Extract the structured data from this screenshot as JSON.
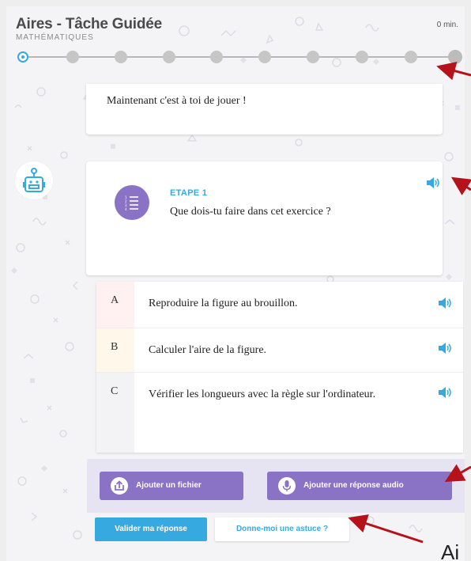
{
  "header": {
    "title": "Aires - Tâche Guidée",
    "subtitle": "MATHÉMATIQUES",
    "timer": "0 min."
  },
  "progress": {
    "current_step": 1,
    "total_steps": 10
  },
  "previous_card": {
    "text": "Maintenant c'est à toi de jouer !"
  },
  "step": {
    "label": "ETAPE 1",
    "question": "Que dois-tu faire dans cet exercice ?",
    "icon": "list-icon"
  },
  "answers": [
    {
      "letter": "A",
      "text": "Reproduire la figure au brouillon."
    },
    {
      "letter": "B",
      "text": "Calculer l'aire de la figure."
    },
    {
      "letter": "C",
      "text": "Vérifier les longueurs avec la règle sur l'ordinateur."
    }
  ],
  "actions": {
    "add_file": "Ajouter un fichier",
    "add_audio": "Ajouter une réponse audio",
    "submit": "Valider ma réponse",
    "hint": "Donne-moi une astuce ?"
  },
  "colors": {
    "accent_blue": "#36a9e1",
    "purple": "#8a72c4",
    "annotation_red": "#b5121b"
  },
  "cut_off_text": "Ai"
}
